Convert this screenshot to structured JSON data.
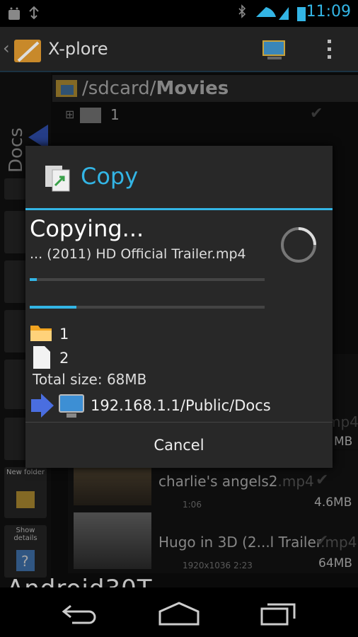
{
  "status_bar": {
    "time": "11:09"
  },
  "app": {
    "title": "X-plore"
  },
  "path_bar": {
    "path_prefix": "/sdcard/",
    "path_folder": "Movies"
  },
  "left_panel": {
    "label": "Docs",
    "items": [
      {
        "label": "New folder"
      },
      {
        "label": "Show details"
      }
    ]
  },
  "background_list": {
    "folder_row": {
      "name": "1"
    },
    "items": [
      {
        "name": "charlie's angels2",
        "ext": ".mp4",
        "meta": "1:06",
        "size": "4.6MB"
      },
      {
        "name": "Hugo in 3D (2...l Trailer",
        "ext": ".mp4",
        "meta": "1920x1036  2:23",
        "size": "64MB"
      }
    ],
    "partial_ext": "mp4",
    "partial_size": "MB"
  },
  "dialog": {
    "title": "Copy",
    "status": "Copying...",
    "current_file": "... (2011) HD Official Trailer.mp4",
    "file_progress": 0.03,
    "total_progress": 0.2,
    "folders_count": "1",
    "files_count": "2",
    "total_size": "Total size: 68MB",
    "destination": "192.168.1.1/Public/Docs",
    "cancel_label": "Cancel"
  },
  "watermark": "Android30T",
  "colors": {
    "accent": "#33b5e5"
  }
}
